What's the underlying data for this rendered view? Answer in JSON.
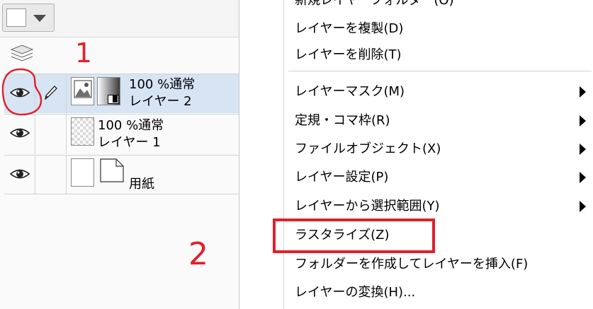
{
  "layer_panel": {
    "layers": [
      {
        "opacity_mode": "100 %通常",
        "name": "レイヤー 2",
        "selected": true,
        "visible": true,
        "editing": true
      },
      {
        "opacity_mode": "100 %通常",
        "name": "レイヤー 1",
        "selected": false,
        "visible": true
      },
      {
        "name": "用紙",
        "selected": false,
        "visible": true
      }
    ],
    "colors": {
      "selected_row": "#d6e4f3"
    }
  },
  "context_menu": {
    "items": [
      {
        "label": "新規レイヤーフォルダー(O)",
        "has_submenu": false
      },
      {
        "label": "レイヤーを複製(D)",
        "has_submenu": false
      },
      {
        "label": "レイヤーを削除(T)",
        "has_submenu": false
      },
      {
        "label": "レイヤーマスク(M)",
        "has_submenu": true
      },
      {
        "label": "定規・コマ枠(R)",
        "has_submenu": true
      },
      {
        "label": "ファイルオブジェクト(X)",
        "has_submenu": true
      },
      {
        "label": "レイヤー設定(P)",
        "has_submenu": true
      },
      {
        "label": "レイヤーから選択範囲(Y)",
        "has_submenu": true
      },
      {
        "label": "ラスタライズ(Z)",
        "has_submenu": false,
        "highlighted": true
      },
      {
        "label": "フォルダーを作成してレイヤーを挿入(F)",
        "has_submenu": false
      },
      {
        "label": "レイヤーの変換(H)...",
        "has_submenu": false
      }
    ]
  },
  "annotations": {
    "step1": "1",
    "step2": "2",
    "color": "#e0202a"
  }
}
